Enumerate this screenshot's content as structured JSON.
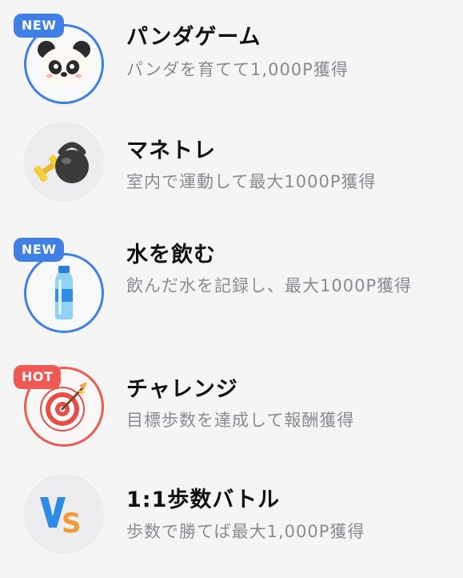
{
  "colors": {
    "badge_new": "#3f7fe6",
    "badge_hot": "#ef5a52",
    "title": "#111111",
    "subtitle": "#8a8b90",
    "background": "#f5f5f6"
  },
  "items": [
    {
      "badge": "NEW",
      "icon": "panda-icon",
      "title": "パンダゲーム",
      "subtitle": "パンダを育てて1,000P獲得"
    },
    {
      "badge": "",
      "icon": "kettlebell-dumbbell-icon",
      "title": "マネトレ",
      "subtitle": "室内で運動して最大1000P獲得"
    },
    {
      "badge": "NEW",
      "icon": "water-bottle-icon",
      "title": "水を飲む",
      "subtitle": "飲んだ水を記録し、最大1000P獲得"
    },
    {
      "badge": "HOT",
      "icon": "target-dart-icon",
      "title": "チャレンジ",
      "subtitle": "目標歩数を達成して報酬獲得"
    },
    {
      "badge": "",
      "icon": "vs-icon",
      "title": "1:1歩数バトル",
      "subtitle": "歩数で勝てば最大1,000P獲得"
    }
  ]
}
